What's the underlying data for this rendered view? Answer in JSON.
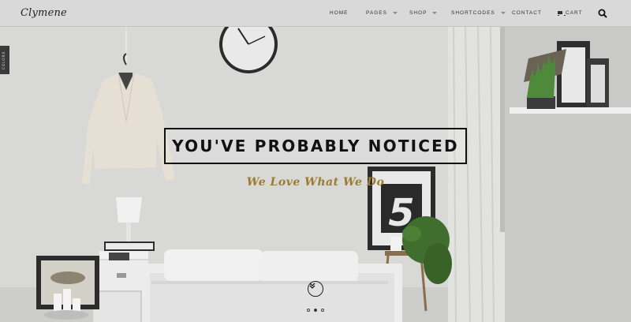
{
  "brand": {
    "logo_text": "Clymene"
  },
  "nav": {
    "items": [
      {
        "label": "HOME",
        "has_dropdown": false
      },
      {
        "label": "PAGES",
        "has_dropdown": true
      },
      {
        "label": "SHOP",
        "has_dropdown": true
      },
      {
        "label": "SHORTCODES",
        "has_dropdown": true
      },
      {
        "label": "CONTACT",
        "has_dropdown": false
      },
      {
        "label": "CART",
        "has_dropdown": false,
        "icon": "cart-icon"
      }
    ],
    "search_icon": "search-icon"
  },
  "colors_tab": {
    "label": "COLORS"
  },
  "hero": {
    "headline": "YOU'VE PROBABLY NOTICED",
    "subheadline": "We Love What We Do",
    "poster_number": "5",
    "slides_total": 3,
    "active_slide": 2,
    "scroll_icon": "chevron-down-icon"
  },
  "colors": {
    "accent": "#9b7d2e",
    "header_bg": "#d9d9d9",
    "headline": "#111111"
  }
}
